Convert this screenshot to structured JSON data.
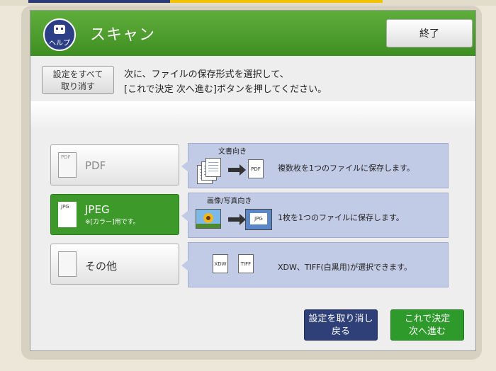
{
  "header": {
    "title": "スキャン",
    "help_label": "ヘルプ",
    "end_label": "終了"
  },
  "toolbar": {
    "reset_line1": "設定をすべて",
    "reset_line2": "取り消す"
  },
  "instruction": {
    "line1": "次に、ファイルの保存形式を選択して、",
    "line2": "[これで決定 次へ進む]ボタンを押してください。"
  },
  "options": [
    {
      "name": "PDF",
      "icon_label": "PDF",
      "selected": false
    },
    {
      "name": "JPEG",
      "icon_label": "JPG",
      "sub": "※[カラー]用です。",
      "selected": true
    },
    {
      "name": "その他",
      "icon_label": "",
      "selected": false
    }
  ],
  "descriptions": [
    {
      "caption": "文書向き",
      "doc_label": "PDF",
      "text": "複数枚を1つのファイルに保存します。"
    },
    {
      "caption": "画像/写真向き",
      "doc_label": "JPG",
      "text": "1枚を1つのファイルに保存します。"
    },
    {
      "doc1": "XDW",
      "doc2": "TIFF",
      "text": "XDW、TIFF(白黒用)が選択できます。"
    }
  ],
  "footer": {
    "cancel_line1": "設定を取り消し",
    "cancel_line2": "戻る",
    "confirm_line1": "これで決定",
    "confirm_line2": "次へ進む"
  },
  "colors": {
    "header_green": "#3f8e22",
    "selected_green": "#3d9a2a",
    "desc_blue": "#c2cbe5",
    "cancel_navy": "#2f3f78"
  }
}
